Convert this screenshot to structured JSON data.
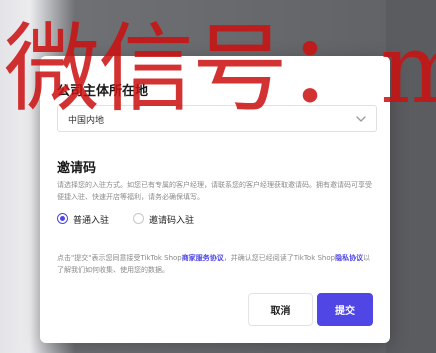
{
  "region_section": {
    "title": "公司主体所在地",
    "selected_value": "中国内地"
  },
  "invite_section": {
    "title": "邀请码",
    "description": "请选择您的入驻方式。如您已有专属的客户经理，请联系您的客户经理获取邀请码。拥有邀请码可享受便捷入驻、快速开店等福利，请务必确保填写。",
    "options": [
      {
        "label": "普通入驻",
        "selected": true
      },
      {
        "label": "邀请码入驻",
        "selected": false
      }
    ]
  },
  "legal": {
    "prefix": "点击\"提交\"表示您同意接受TikTok Shop",
    "link1": "商家服务协议",
    "middle": "，并确认您已经阅读了TikTok Shop",
    "link2": "隐私协议",
    "suffix": "以了解我们如何收集、使用您的数据。"
  },
  "buttons": {
    "cancel_label": "取消",
    "submit_label": "提交"
  },
  "watermark": {
    "text": "微信号：muhuanidc"
  },
  "colors": {
    "accent": "#4f46e5",
    "watermark": "#cc1010"
  }
}
